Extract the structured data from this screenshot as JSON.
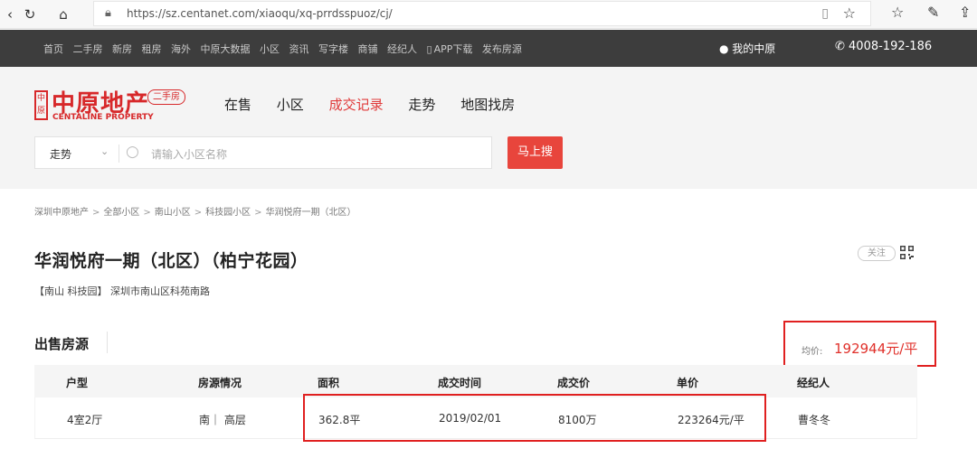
{
  "browser": {
    "url": "https://sz.centanet.com/xiaoqu/xq-prrdsspuoz/cj/",
    "back_icon": "back-icon",
    "refresh_icon": "refresh-icon",
    "home_icon": "home-icon"
  },
  "topnav": {
    "links": [
      "首页",
      "二手房",
      "新房",
      "租房",
      "海外",
      "中原大数据",
      "小区",
      "资讯",
      "写字楼",
      "商铺",
      "经纪人",
      "APP下载",
      "发布房源"
    ],
    "my_label": "我的中原",
    "phone": "4008-192-186"
  },
  "brand": {
    "name_cn": "中原地产",
    "name_en": "CENTALINE PROPERTY",
    "tag": "二手房"
  },
  "mainnav": {
    "items": [
      "在售",
      "小区",
      "成交记录",
      "走势",
      "地图找房"
    ],
    "active": "成交记录"
  },
  "search": {
    "selected": "走势",
    "placeholder": "请输入小区名称",
    "button": "马上搜"
  },
  "breadcrumb": [
    "深圳中原地产",
    "全部小区",
    "南山小区",
    "科技园小区",
    "华润悦府一期（北区）"
  ],
  "estate": {
    "title": "华润悦府一期（北区）（柏宁花园）",
    "follow_label": "关注",
    "address": "【南山 科技园】 深圳市南山区科苑南路"
  },
  "section": {
    "title": "出售房源",
    "avg_label": "均价:",
    "avg_value": "192944元/平"
  },
  "table": {
    "headers": [
      "户型",
      "房源情况",
      "面积",
      "成交时间",
      "成交价",
      "单价",
      "经纪人"
    ],
    "rows": [
      [
        "4室2厅",
        "南｜ 高层",
        "362.8平",
        "2019/02/01",
        "8100万",
        "223264元/平",
        "曹冬冬"
      ]
    ]
  },
  "colors": {
    "accent": "#e03a3a",
    "nav_bg": "#3d3d3d",
    "highlight_border": "#e02020"
  }
}
